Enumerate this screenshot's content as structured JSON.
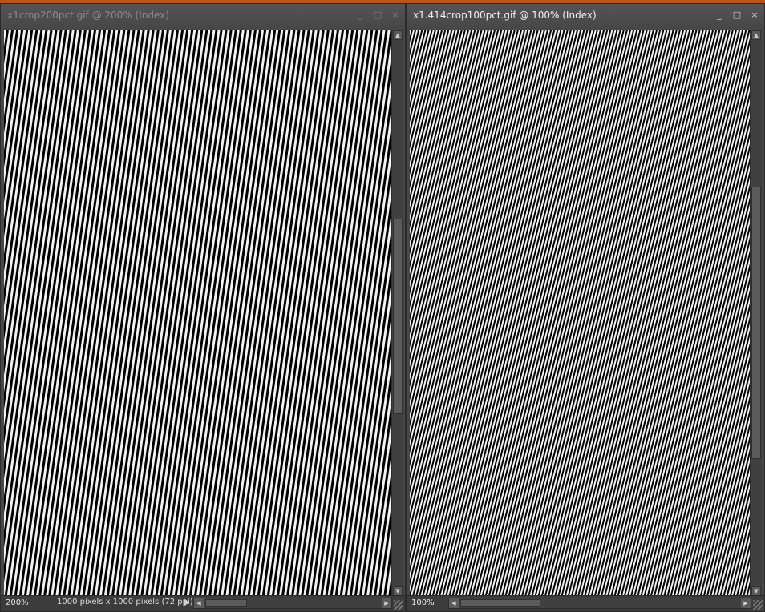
{
  "left_window": {
    "title": "x1crop200pct.gif @ 200% (Index)",
    "zoom": "200%",
    "info": "1000 pixels x 1000 pixels (72 ppi)",
    "controls": {
      "minimize": "_",
      "maximize": "□",
      "close": "×"
    }
  },
  "right_window": {
    "title": "x1.414crop100pct.gif @ 100% (Index)",
    "zoom": "100%",
    "controls": {
      "minimize": "_",
      "maximize": "□",
      "close": "×"
    }
  },
  "colors": {
    "accent": "#c2501a",
    "chrome": "#474747"
  },
  "icons": [
    "minimize-icon",
    "maximize-icon",
    "close-icon",
    "scroll-up-icon",
    "scroll-down-icon",
    "scroll-left-icon",
    "scroll-right-icon",
    "play-icon"
  ]
}
